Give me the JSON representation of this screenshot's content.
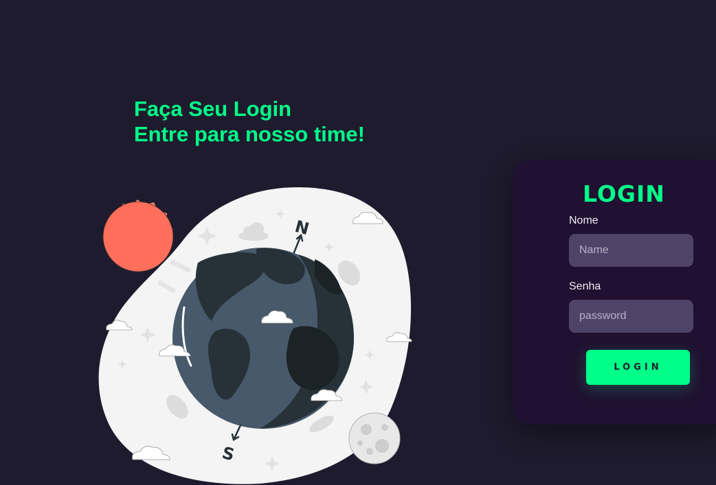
{
  "hero": {
    "line1": "Faça Seu Login",
    "line2": "Entre para nosso time!"
  },
  "illustration": {
    "north_label": "N",
    "south_label": "S",
    "icons": [
      "sun-icon",
      "globe-icon",
      "moon-icon",
      "cloud-icon",
      "compass-arrow-icon"
    ]
  },
  "login": {
    "title": "LOGIN",
    "name_label": "Nome",
    "name_placeholder": "Name",
    "password_label": "Senha",
    "password_placeholder": "password",
    "button_label": "LOGIN"
  },
  "colors": {
    "background": "#1f1b2e",
    "accent": "#00ff88",
    "card": "#201031",
    "input": "#4f4468"
  }
}
